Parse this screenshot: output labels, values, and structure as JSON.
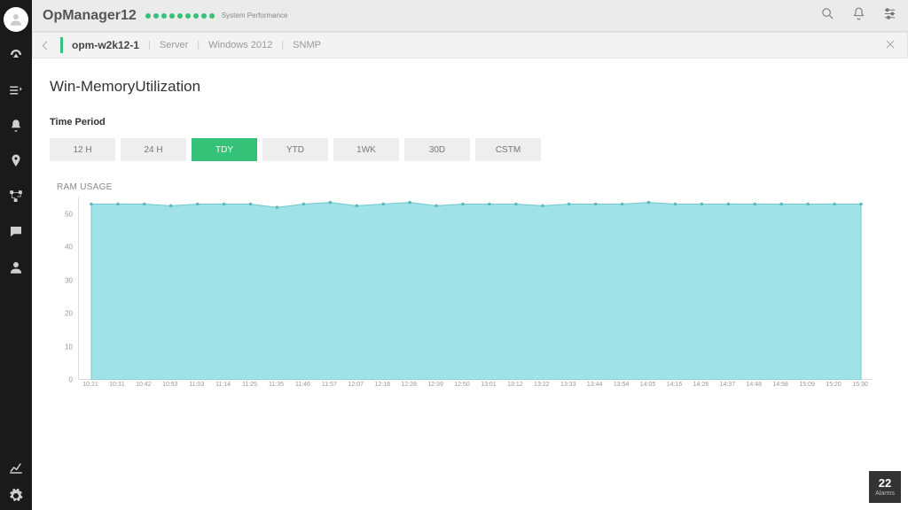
{
  "header": {
    "product": "OpManager12",
    "sub": "System Performance"
  },
  "crumb": {
    "host": "opm-w2k12-1",
    "type": "Server",
    "os": "Windows 2012",
    "proto": "SNMP"
  },
  "page": {
    "title": "Win-MemoryUtilization",
    "period_label": "Time Period"
  },
  "periods": [
    "12 H",
    "24 H",
    "TDY",
    "YTD",
    "1WK",
    "30D",
    "CSTM"
  ],
  "period_active": 2,
  "alarms": {
    "count": "22",
    "label": "Alarms"
  },
  "chart_data": {
    "type": "area",
    "title": "RAM USAGE",
    "xlabel": "",
    "ylabel": "",
    "ylim": [
      0,
      55
    ],
    "y_ticks": [
      0,
      10,
      20,
      30,
      40,
      50
    ],
    "categories": [
      "10:21",
      "10:31",
      "10:42",
      "10:53",
      "11:03",
      "11:14",
      "11:25",
      "11:35",
      "11:46",
      "11:57",
      "12:07",
      "12:18",
      "12:28",
      "12:39",
      "12:50",
      "13:01",
      "13:12",
      "13:22",
      "13:33",
      "13:44",
      "13:54",
      "14:05",
      "14:16",
      "14:26",
      "14:37",
      "14:48",
      "14:58",
      "15:09",
      "15:20",
      "15:30"
    ],
    "values": [
      53,
      53,
      53,
      52.5,
      53,
      53,
      53,
      52,
      53,
      53.5,
      52.5,
      53,
      53.5,
      52.5,
      53,
      53,
      53,
      52.5,
      53,
      53,
      53,
      53.5,
      53,
      53,
      53,
      53,
      53,
      53,
      53,
      53,
      53
    ]
  }
}
